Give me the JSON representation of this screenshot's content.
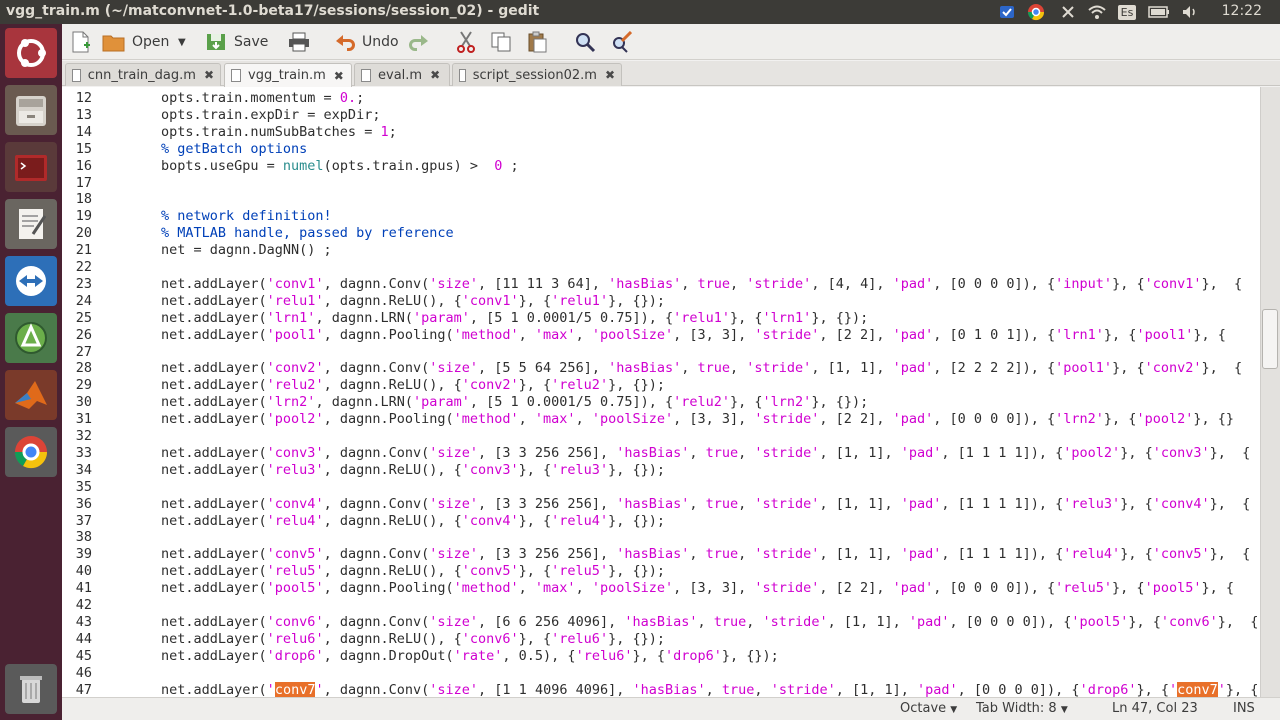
{
  "window_title": "vgg_train.m (~/matconvnet-1.0-beta17/sessions/session_02) - gedit",
  "clock": "12:22",
  "keyboard_indicator": "Es",
  "toolbar": {
    "open_label": "Open",
    "save_label": "Save",
    "undo_label": "Undo"
  },
  "tabs": [
    {
      "label": "cnn_train_dag.m",
      "close": "✖"
    },
    {
      "label": "vgg_train.m",
      "close": "✖"
    },
    {
      "label": "eval.m",
      "close": "✖"
    },
    {
      "label": "script_session02.m",
      "close": "✖"
    }
  ],
  "code_lines": [
    {
      "num": "12",
      "text": "opts.train.momentum = 0.;"
    },
    {
      "num": "13",
      "text": "opts.train.expDir = expDir;"
    },
    {
      "num": "14",
      "text": "opts.train.numSubBatches = 1;"
    },
    {
      "num": "15",
      "text": "% getBatch options"
    },
    {
      "num": "16",
      "text": "bopts.useGpu = numel(opts.train.gpus) >  0 ;"
    },
    {
      "num": "17",
      "text": ""
    },
    {
      "num": "18",
      "text": ""
    },
    {
      "num": "19",
      "text": "% network definition!"
    },
    {
      "num": "20",
      "text": "% MATLAB handle, passed by reference"
    },
    {
      "num": "21",
      "text": "net = dagnn.DagNN() ;"
    },
    {
      "num": "22",
      "text": ""
    },
    {
      "num": "23",
      "text": "net.addLayer('conv1', dagnn.Conv('size', [11 11 3 64], 'hasBias', true, 'stride', [4, 4], 'pad', [0 0 0 0]), {'input'}, {'conv1'},  {"
    },
    {
      "num": "24",
      "text": "net.addLayer('relu1', dagnn.ReLU(), {'conv1'}, {'relu1'}, {});"
    },
    {
      "num": "25",
      "text": "net.addLayer('lrn1', dagnn.LRN('param', [5 1 0.0001/5 0.75]), {'relu1'}, {'lrn1'}, {});"
    },
    {
      "num": "26",
      "text": "net.addLayer('pool1', dagnn.Pooling('method', 'max', 'poolSize', [3, 3], 'stride', [2 2], 'pad', [0 1 0 1]), {'lrn1'}, {'pool1'}, {"
    },
    {
      "num": "27",
      "text": ""
    },
    {
      "num": "28",
      "text": "net.addLayer('conv2', dagnn.Conv('size', [5 5 64 256], 'hasBias', true, 'stride', [1, 1], 'pad', [2 2 2 2]), {'pool1'}, {'conv2'},  {"
    },
    {
      "num": "29",
      "text": "net.addLayer('relu2', dagnn.ReLU(), {'conv2'}, {'relu2'}, {});"
    },
    {
      "num": "30",
      "text": "net.addLayer('lrn2', dagnn.LRN('param', [5 1 0.0001/5 0.75]), {'relu2'}, {'lrn2'}, {});"
    },
    {
      "num": "31",
      "text": "net.addLayer('pool2', dagnn.Pooling('method', 'max', 'poolSize', [3, 3], 'stride', [2 2], 'pad', [0 0 0 0]), {'lrn2'}, {'pool2'}, {}"
    },
    {
      "num": "32",
      "text": ""
    },
    {
      "num": "33",
      "text": "net.addLayer('conv3', dagnn.Conv('size', [3 3 256 256], 'hasBias', true, 'stride', [1, 1], 'pad', [1 1 1 1]), {'pool2'}, {'conv3'},  {"
    },
    {
      "num": "34",
      "text": "net.addLayer('relu3', dagnn.ReLU(), {'conv3'}, {'relu3'}, {});"
    },
    {
      "num": "35",
      "text": ""
    },
    {
      "num": "36",
      "text": "net.addLayer('conv4', dagnn.Conv('size', [3 3 256 256], 'hasBias', true, 'stride', [1, 1], 'pad', [1 1 1 1]), {'relu3'}, {'conv4'},  {"
    },
    {
      "num": "37",
      "text": "net.addLayer('relu4', dagnn.ReLU(), {'conv4'}, {'relu4'}, {});"
    },
    {
      "num": "38",
      "text": ""
    },
    {
      "num": "39",
      "text": "net.addLayer('conv5', dagnn.Conv('size', [3 3 256 256], 'hasBias', true, 'stride', [1, 1], 'pad', [1 1 1 1]), {'relu4'}, {'conv5'},  {"
    },
    {
      "num": "40",
      "text": "net.addLayer('relu5', dagnn.ReLU(), {'conv5'}, {'relu5'}, {});"
    },
    {
      "num": "41",
      "text": "net.addLayer('pool5', dagnn.Pooling('method', 'max', 'poolSize', [3, 3], 'stride', [2 2], 'pad', [0 0 0 0]), {'relu5'}, {'pool5'}, {"
    },
    {
      "num": "42",
      "text": ""
    },
    {
      "num": "43",
      "text": "net.addLayer('conv6', dagnn.Conv('size', [6 6 256 4096], 'hasBias', true, 'stride', [1, 1], 'pad', [0 0 0 0]), {'pool5'}, {'conv6'},  {"
    },
    {
      "num": "44",
      "text": "net.addLayer('relu6', dagnn.ReLU(), {'conv6'}, {'relu6'}, {});"
    },
    {
      "num": "45",
      "text": "net.addLayer('drop6', dagnn.DropOut('rate', 0.5), {'relu6'}, {'drop6'}, {});"
    },
    {
      "num": "46",
      "text": ""
    },
    {
      "num": "47",
      "text": "net.addLayer('conv7', dagnn.Conv('size', [1 1 4096 4096], 'hasBias', true, 'stride', [1, 1], 'pad', [0 0 0 0]), {'drop6'}, {'conv7'}, {"
    }
  ],
  "selected_text": "conv7",
  "status": {
    "language": "Octave",
    "tab_width": "Tab Width: 8",
    "cursor": "Ln 47, Col 23",
    "mode": "INS"
  },
  "colors": {
    "string": "#d000d0",
    "comment": "#0040b8",
    "builtin": "#2a8d8d",
    "selection": "#e8702a",
    "launcher_bg": "#4a2232",
    "panel_bg": "#3c3b37"
  },
  "launcher_icons": [
    "ubuntu-dash-icon",
    "file-manager-icon",
    "terminal-icon",
    "text-editor-icon",
    "teamviewer-icon",
    "software-updater-icon",
    "matlab-icon",
    "chrome-icon",
    "trash-icon"
  ]
}
